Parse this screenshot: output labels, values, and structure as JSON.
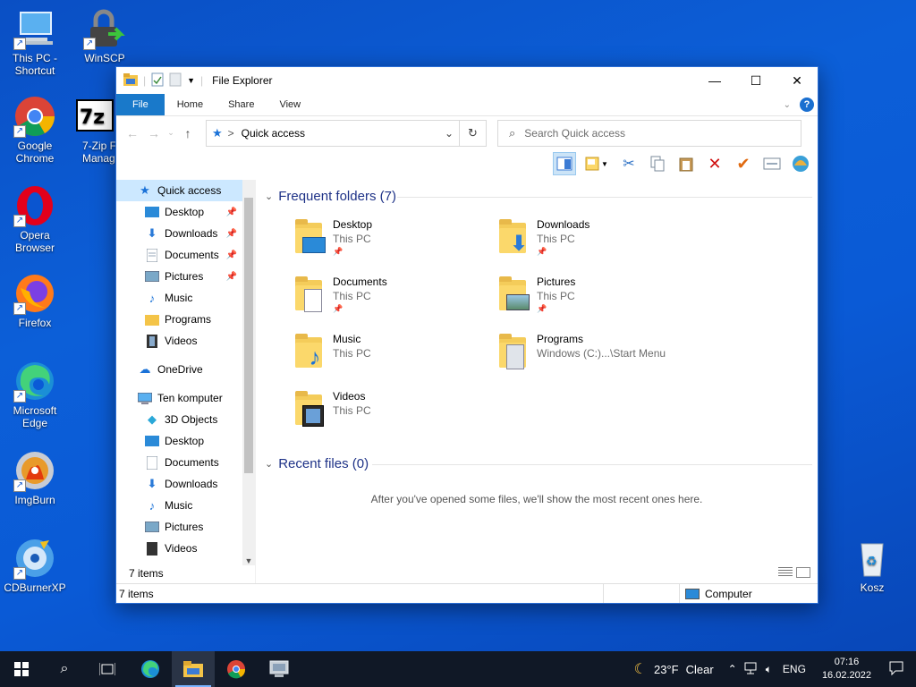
{
  "desktop": {
    "icons": [
      {
        "label": "This PC - Shortcut"
      },
      {
        "label": "WinSCP"
      },
      {
        "label": "Google Chrome"
      },
      {
        "label": "7-Zip F Manag"
      },
      {
        "label": "Opera Browser"
      },
      {
        "label": "Firefox"
      },
      {
        "label": "Microsoft Edge"
      },
      {
        "label": "ImgBurn"
      },
      {
        "label": "CDBurnerXP"
      },
      {
        "label": "Kosz"
      }
    ]
  },
  "window": {
    "title": "File Explorer",
    "controls": {
      "minimize": "—",
      "maximize": "☐",
      "close": "✕"
    },
    "tabs": {
      "file": "File",
      "home": "Home",
      "share": "Share",
      "view": "View"
    },
    "help": "?",
    "address": {
      "location": "Quick access",
      "separator": ">"
    },
    "search": {
      "placeholder": "Search Quick access"
    },
    "nav": {
      "items": [
        {
          "label": "Quick access"
        },
        {
          "label": "Desktop"
        },
        {
          "label": "Downloads"
        },
        {
          "label": "Documents"
        },
        {
          "label": "Pictures"
        },
        {
          "label": "Music"
        },
        {
          "label": "Programs"
        },
        {
          "label": "Videos"
        },
        {
          "label": "OneDrive"
        },
        {
          "label": "Ten komputer"
        },
        {
          "label": "3D Objects"
        },
        {
          "label": "Desktop"
        },
        {
          "label": "Documents"
        },
        {
          "label": "Downloads"
        },
        {
          "label": "Music"
        },
        {
          "label": "Pictures"
        },
        {
          "label": "Videos"
        }
      ],
      "count": "7 items"
    },
    "frequent": {
      "heading": "Frequent folders (7)",
      "folders": [
        {
          "name": "Desktop",
          "location": "This PC"
        },
        {
          "name": "Downloads",
          "location": "This PC"
        },
        {
          "name": "Documents",
          "location": "This PC"
        },
        {
          "name": "Pictures",
          "location": "This PC"
        },
        {
          "name": "Music",
          "location": "This PC"
        },
        {
          "name": "Programs",
          "location": "Windows (C:)...\\Start Menu"
        },
        {
          "name": "Videos",
          "location": "This PC"
        }
      ]
    },
    "recent": {
      "heading": "Recent files (0)",
      "empty_message": "After you've opened some files, we'll show the most recent ones here."
    },
    "status": {
      "count": "7 items",
      "location": "Computer"
    }
  },
  "taskbar": {
    "weather": {
      "temp": "23°F",
      "condition": "Clear"
    },
    "language": "ENG",
    "time": "07:16",
    "date": "16.02.2022"
  }
}
